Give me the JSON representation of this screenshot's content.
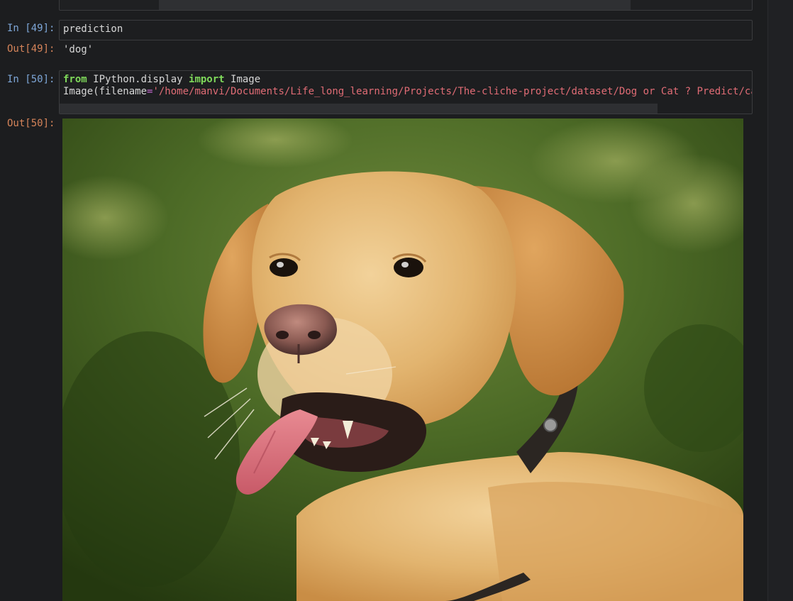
{
  "cells": [
    {
      "in_prompt": "In [49]:",
      "code": "prediction",
      "out_prompt": "Out[49]:",
      "output": "'dog'"
    },
    {
      "in_prompt": "In [50]:",
      "code_line1": {
        "kw_from": "from",
        "module": " IPython.display ",
        "kw_import": "import",
        "name": " Image"
      },
      "code_line2": {
        "call": "Image(filename",
        "eq": "=",
        "path": "'/home/manvi/Documents/Life_long_learning/Projects/The-cliche-project/dataset/Dog or Cat ? Predict/ca"
      },
      "out_prompt": "Out[50]:",
      "output_image": "dog-photo"
    }
  ],
  "colors": {
    "background": "#1c1d1f",
    "in_prompt": "#7ea7d8",
    "out_prompt": "#d6845a",
    "keyword": "#7fd95a",
    "string": "#e06c75",
    "operator": "#c96bd4"
  }
}
